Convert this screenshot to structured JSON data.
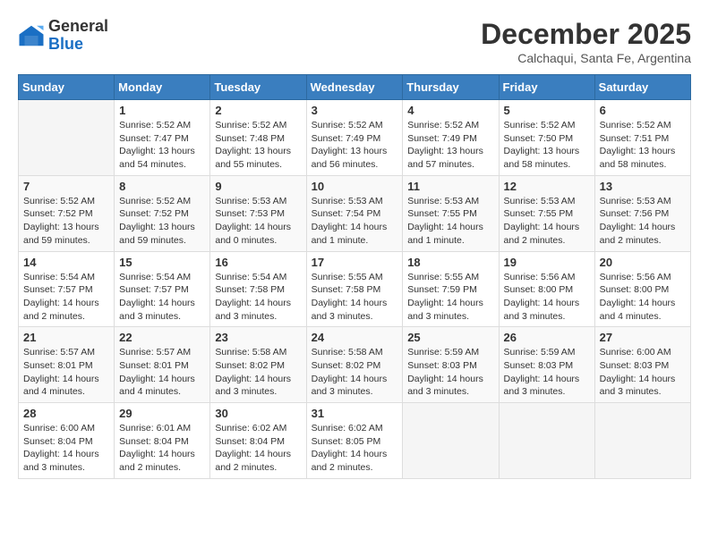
{
  "logo": {
    "general": "General",
    "blue": "Blue"
  },
  "title": "December 2025",
  "location": "Calchaqui, Santa Fe, Argentina",
  "days_of_week": [
    "Sunday",
    "Monday",
    "Tuesday",
    "Wednesday",
    "Thursday",
    "Friday",
    "Saturday"
  ],
  "weeks": [
    [
      {
        "num": "",
        "info": ""
      },
      {
        "num": "1",
        "info": "Sunrise: 5:52 AM\nSunset: 7:47 PM\nDaylight: 13 hours\nand 54 minutes."
      },
      {
        "num": "2",
        "info": "Sunrise: 5:52 AM\nSunset: 7:48 PM\nDaylight: 13 hours\nand 55 minutes."
      },
      {
        "num": "3",
        "info": "Sunrise: 5:52 AM\nSunset: 7:49 PM\nDaylight: 13 hours\nand 56 minutes."
      },
      {
        "num": "4",
        "info": "Sunrise: 5:52 AM\nSunset: 7:49 PM\nDaylight: 13 hours\nand 57 minutes."
      },
      {
        "num": "5",
        "info": "Sunrise: 5:52 AM\nSunset: 7:50 PM\nDaylight: 13 hours\nand 58 minutes."
      },
      {
        "num": "6",
        "info": "Sunrise: 5:52 AM\nSunset: 7:51 PM\nDaylight: 13 hours\nand 58 minutes."
      }
    ],
    [
      {
        "num": "7",
        "info": "Sunrise: 5:52 AM\nSunset: 7:52 PM\nDaylight: 13 hours\nand 59 minutes."
      },
      {
        "num": "8",
        "info": "Sunrise: 5:52 AM\nSunset: 7:52 PM\nDaylight: 13 hours\nand 59 minutes."
      },
      {
        "num": "9",
        "info": "Sunrise: 5:53 AM\nSunset: 7:53 PM\nDaylight: 14 hours\nand 0 minutes."
      },
      {
        "num": "10",
        "info": "Sunrise: 5:53 AM\nSunset: 7:54 PM\nDaylight: 14 hours\nand 1 minute."
      },
      {
        "num": "11",
        "info": "Sunrise: 5:53 AM\nSunset: 7:55 PM\nDaylight: 14 hours\nand 1 minute."
      },
      {
        "num": "12",
        "info": "Sunrise: 5:53 AM\nSunset: 7:55 PM\nDaylight: 14 hours\nand 2 minutes."
      },
      {
        "num": "13",
        "info": "Sunrise: 5:53 AM\nSunset: 7:56 PM\nDaylight: 14 hours\nand 2 minutes."
      }
    ],
    [
      {
        "num": "14",
        "info": "Sunrise: 5:54 AM\nSunset: 7:57 PM\nDaylight: 14 hours\nand 2 minutes."
      },
      {
        "num": "15",
        "info": "Sunrise: 5:54 AM\nSunset: 7:57 PM\nDaylight: 14 hours\nand 3 minutes."
      },
      {
        "num": "16",
        "info": "Sunrise: 5:54 AM\nSunset: 7:58 PM\nDaylight: 14 hours\nand 3 minutes."
      },
      {
        "num": "17",
        "info": "Sunrise: 5:55 AM\nSunset: 7:58 PM\nDaylight: 14 hours\nand 3 minutes."
      },
      {
        "num": "18",
        "info": "Sunrise: 5:55 AM\nSunset: 7:59 PM\nDaylight: 14 hours\nand 3 minutes."
      },
      {
        "num": "19",
        "info": "Sunrise: 5:56 AM\nSunset: 8:00 PM\nDaylight: 14 hours\nand 3 minutes."
      },
      {
        "num": "20",
        "info": "Sunrise: 5:56 AM\nSunset: 8:00 PM\nDaylight: 14 hours\nand 4 minutes."
      }
    ],
    [
      {
        "num": "21",
        "info": "Sunrise: 5:57 AM\nSunset: 8:01 PM\nDaylight: 14 hours\nand 4 minutes."
      },
      {
        "num": "22",
        "info": "Sunrise: 5:57 AM\nSunset: 8:01 PM\nDaylight: 14 hours\nand 4 minutes."
      },
      {
        "num": "23",
        "info": "Sunrise: 5:58 AM\nSunset: 8:02 PM\nDaylight: 14 hours\nand 3 minutes."
      },
      {
        "num": "24",
        "info": "Sunrise: 5:58 AM\nSunset: 8:02 PM\nDaylight: 14 hours\nand 3 minutes."
      },
      {
        "num": "25",
        "info": "Sunrise: 5:59 AM\nSunset: 8:03 PM\nDaylight: 14 hours\nand 3 minutes."
      },
      {
        "num": "26",
        "info": "Sunrise: 5:59 AM\nSunset: 8:03 PM\nDaylight: 14 hours\nand 3 minutes."
      },
      {
        "num": "27",
        "info": "Sunrise: 6:00 AM\nSunset: 8:03 PM\nDaylight: 14 hours\nand 3 minutes."
      }
    ],
    [
      {
        "num": "28",
        "info": "Sunrise: 6:00 AM\nSunset: 8:04 PM\nDaylight: 14 hours\nand 3 minutes."
      },
      {
        "num": "29",
        "info": "Sunrise: 6:01 AM\nSunset: 8:04 PM\nDaylight: 14 hours\nand 2 minutes."
      },
      {
        "num": "30",
        "info": "Sunrise: 6:02 AM\nSunset: 8:04 PM\nDaylight: 14 hours\nand 2 minutes."
      },
      {
        "num": "31",
        "info": "Sunrise: 6:02 AM\nSunset: 8:05 PM\nDaylight: 14 hours\nand 2 minutes."
      },
      {
        "num": "",
        "info": ""
      },
      {
        "num": "",
        "info": ""
      },
      {
        "num": "",
        "info": ""
      }
    ]
  ]
}
